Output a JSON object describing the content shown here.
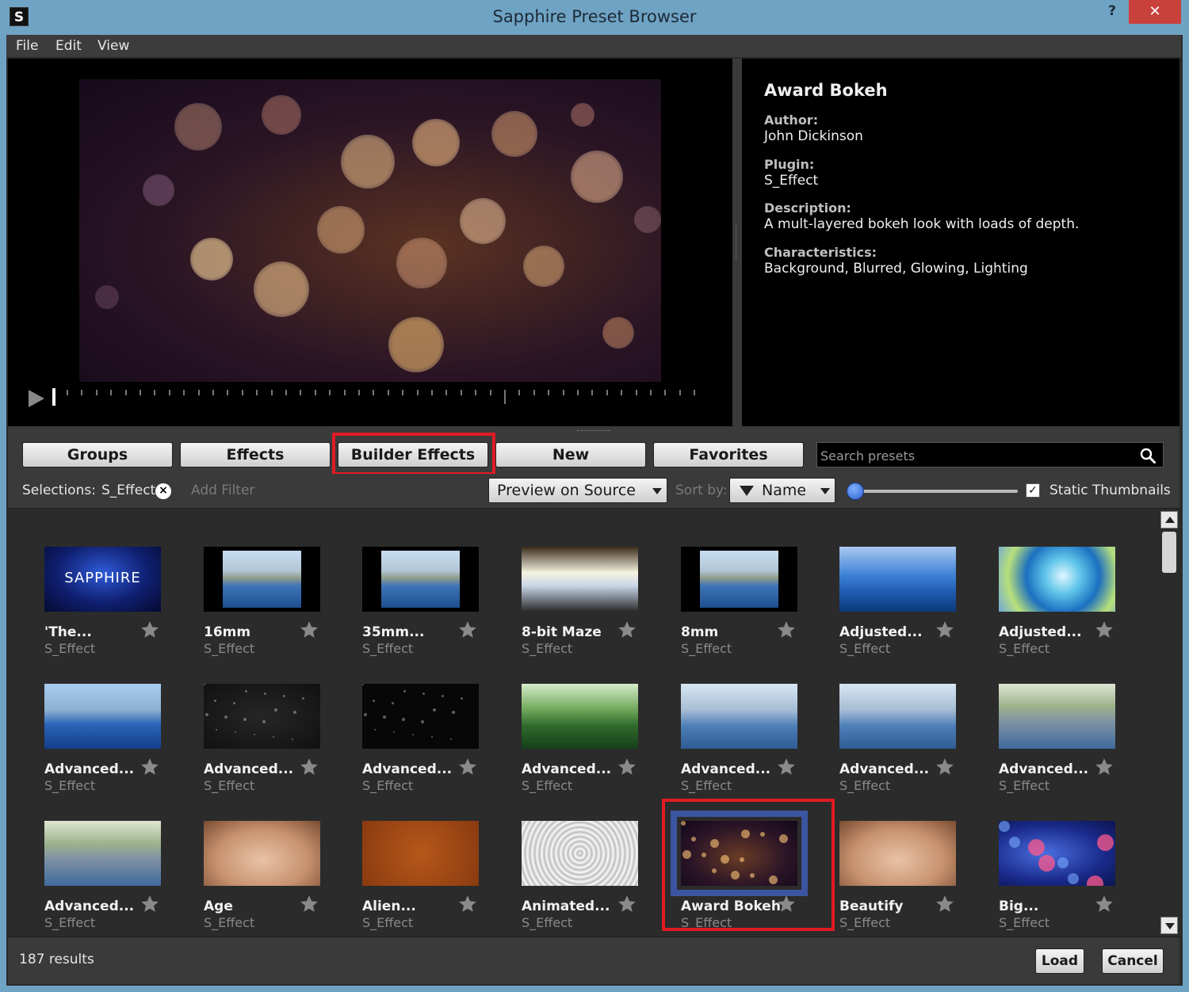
{
  "window": {
    "title": "Sapphire Preset Browser",
    "help_label": "?",
    "close_label": "✕",
    "app_icon_letter": "S"
  },
  "menu": [
    "File",
    "Edit",
    "View"
  ],
  "info": {
    "title": "Award Bokeh",
    "author_label": "Author:",
    "author": "John Dickinson",
    "plugin_label": "Plugin:",
    "plugin": "S_Effect",
    "description_label": "Description:",
    "description": "A mult-layered bokeh look with loads of depth.",
    "characteristics_label": "Characteristics:",
    "characteristics": "Background, Blurred, Glowing, Lighting"
  },
  "tabs": [
    "Groups",
    "Effects",
    "Builder Effects",
    "New",
    "Favorites"
  ],
  "search": {
    "placeholder": "Search presets"
  },
  "filters": {
    "selections_label": "Selections:",
    "selection_value": "S_Effect",
    "clear_symbol": "×",
    "add_filter": "Add Filter",
    "preview_mode": "Preview on Source",
    "sort_label": "Sort by:",
    "sort_value": "Name",
    "static_thumbnails_label": "Static Thumbnails",
    "static_thumbnails_checked": true,
    "thumbnail_size_fraction": 0
  },
  "presets": [
    {
      "name": "'The...",
      "plugin": "S_Effect",
      "thumb": "sapphire-logo",
      "logo_text": "SAPPHIRE"
    },
    {
      "name": "16mm",
      "plugin": "S_Effect",
      "thumb": "city-framed"
    },
    {
      "name": "35mm...",
      "plugin": "S_Effect",
      "thumb": "city-framed"
    },
    {
      "name": "8-bit Maze",
      "plugin": "S_Effect",
      "thumb": "glitch"
    },
    {
      "name": "8mm",
      "plugin": "S_Effect",
      "thumb": "city-framed"
    },
    {
      "name": "Adjusted...",
      "plugin": "S_Effect",
      "thumb": "city-blue"
    },
    {
      "name": "Adjusted...",
      "plugin": "S_Effect",
      "thumb": "city-rings"
    },
    {
      "name": "Advanced...",
      "plugin": "S_Effect",
      "thumb": "city"
    },
    {
      "name": "Advanced...",
      "plugin": "S_Effect",
      "thumb": "dark-particles"
    },
    {
      "name": "Advanced...",
      "plugin": "S_Effect",
      "thumb": "dark-particles-2"
    },
    {
      "name": "Advanced...",
      "plugin": "S_Effect",
      "thumb": "city-green"
    },
    {
      "name": "Advanced...",
      "plugin": "S_Effect",
      "thumb": "city-soft"
    },
    {
      "name": "Advanced...",
      "plugin": "S_Effect",
      "thumb": "city-soft"
    },
    {
      "name": "Advanced...",
      "plugin": "S_Effect",
      "thumb": "city-blur"
    },
    {
      "name": "Advanced...",
      "plugin": "S_Effect",
      "thumb": "city-blur"
    },
    {
      "name": "Age",
      "plugin": "S_Effect",
      "thumb": "face"
    },
    {
      "name": "Alien...",
      "plugin": "S_Effect",
      "thumb": "alien"
    },
    {
      "name": "Animated...",
      "plugin": "S_Effect",
      "thumb": "pattern"
    },
    {
      "name": "Award Bokeh",
      "plugin": "S_Effect",
      "thumb": "bokeh",
      "selected": true
    },
    {
      "name": "Beautify",
      "plugin": "S_Effect",
      "thumb": "face"
    },
    {
      "name": "Big...",
      "plugin": "S_Effect",
      "thumb": "big-bokeh"
    }
  ],
  "footer": {
    "results": "187 results",
    "load_label": "Load",
    "cancel_label": "Cancel"
  },
  "colors": {
    "titlebar": "#6fa3c4",
    "panel": "#3a3a3a",
    "grid_bg": "#2b2b2b",
    "annotation_red": "#e11b22",
    "selection_blue": "#3b55a0",
    "close_red": "#c9413b"
  }
}
